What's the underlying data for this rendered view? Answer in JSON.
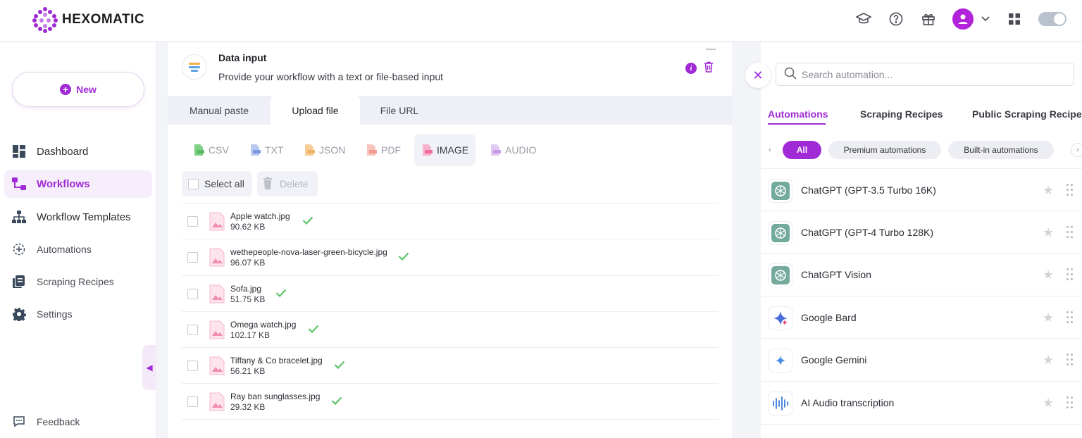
{
  "app": {
    "name": "HEXOMATIC",
    "brand_color": "#a02ad6"
  },
  "topbar": {
    "icons": [
      "academy-icon",
      "help-icon",
      "gift-icon",
      "avatar",
      "chevron-down-icon",
      "apps-grid-icon",
      "theme-toggle"
    ]
  },
  "sidebar": {
    "new_label": "New",
    "items": [
      {
        "label": "Dashboard",
        "icon": "dashboard-icon"
      },
      {
        "label": "Workflows",
        "icon": "workflows-icon",
        "active": true
      },
      {
        "label": "Workflow Templates",
        "icon": "templates-icon"
      },
      {
        "label": "Automations",
        "icon": "automations-icon"
      },
      {
        "label": "Scraping Recipes",
        "icon": "scraping-recipes-icon"
      },
      {
        "label": "Settings",
        "icon": "gear-icon"
      }
    ],
    "feedback_label": "Feedback"
  },
  "data_input": {
    "title": "Data input",
    "subtitle": "Provide your workflow with a text or file-based input",
    "tabs": [
      {
        "label": "Manual paste"
      },
      {
        "label": "Upload file",
        "active": true
      },
      {
        "label": "File URL"
      }
    ],
    "file_types": [
      {
        "label": "CSV",
        "color": "#7fcf85"
      },
      {
        "label": "TXT",
        "color": "#8ea6e6"
      },
      {
        "label": "JSON",
        "color": "#f1b56a"
      },
      {
        "label": "PDF",
        "color": "#f29a8f"
      },
      {
        "label": "IMAGE",
        "color": "#f06d9b",
        "active": true
      },
      {
        "label": "AUDIO",
        "color": "#c79ae8"
      }
    ],
    "select_all_label": "Select all",
    "delete_label": "Delete",
    "files": [
      {
        "name": "Apple watch.jpg",
        "size": "90.62 KB"
      },
      {
        "name": "wethepeople-nova-laser-green-bicycle.jpg",
        "size": "96.07 KB"
      },
      {
        "name": "Sofa.jpg",
        "size": "51.75 KB"
      },
      {
        "name": "Omega watch.jpg",
        "size": "102.17 KB"
      },
      {
        "name": "Tiffany & Co bracelet.jpg",
        "size": "56.21 KB"
      },
      {
        "name": "Ray ban sunglasses.jpg",
        "size": "29.32 KB"
      }
    ]
  },
  "automation_panel": {
    "search_placeholder": "Search automation...",
    "tabs": [
      {
        "label": "Automations",
        "active": true
      },
      {
        "label": "Scraping Recipes"
      },
      {
        "label": "Public Scraping Recipes"
      }
    ],
    "chips": [
      {
        "label": "All",
        "active": true
      },
      {
        "label": "Premium automations"
      },
      {
        "label": "Built-in automations"
      }
    ],
    "items": [
      {
        "label": "ChatGPT (GPT-3.5 Turbo 16K)",
        "icon": "chatgpt-icon"
      },
      {
        "label": "ChatGPT (GPT-4 Turbo 128K)",
        "icon": "chatgpt-icon"
      },
      {
        "label": "ChatGPT Vision",
        "icon": "chatgpt-icon"
      },
      {
        "label": "Google Bard",
        "icon": "google-bard-icon"
      },
      {
        "label": "Google Gemini",
        "icon": "google-gemini-icon"
      },
      {
        "label": "AI Audio transcription",
        "icon": "audio-waveform-icon"
      }
    ]
  }
}
